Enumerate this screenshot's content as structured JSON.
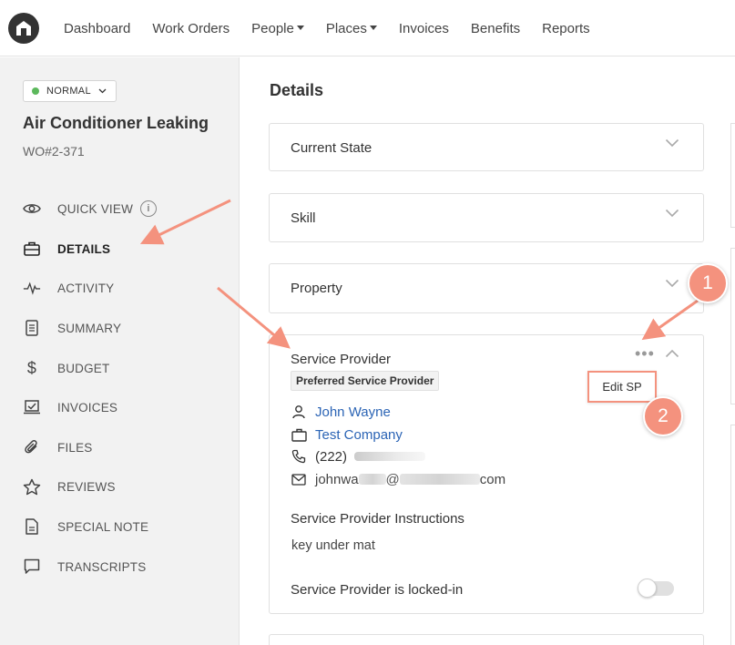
{
  "nav": {
    "items": [
      {
        "label": "Dashboard",
        "dropdown": false
      },
      {
        "label": "Work Orders",
        "dropdown": false
      },
      {
        "label": "People",
        "dropdown": true
      },
      {
        "label": "Places",
        "dropdown": true
      },
      {
        "label": "Invoices",
        "dropdown": false
      },
      {
        "label": "Benefits",
        "dropdown": false
      },
      {
        "label": "Reports",
        "dropdown": false
      }
    ]
  },
  "sidebar": {
    "status": "NORMAL",
    "status_color": "#5cb85c",
    "title": "Air Conditioner Leaking",
    "wo_number": "WO#2-371",
    "items": [
      {
        "label": "QUICK VIEW",
        "icon": "eye-icon",
        "active": false,
        "info": true
      },
      {
        "label": "DETAILS",
        "icon": "briefcase-icon",
        "active": true
      },
      {
        "label": "ACTIVITY",
        "icon": "pulse-icon",
        "active": false
      },
      {
        "label": "SUMMARY",
        "icon": "document-icon",
        "active": false
      },
      {
        "label": "BUDGET",
        "icon": "dollar-icon",
        "active": false
      },
      {
        "label": "INVOICES",
        "icon": "invoice-icon",
        "active": false
      },
      {
        "label": "FILES",
        "icon": "paperclip-icon",
        "active": false
      },
      {
        "label": "REVIEWS",
        "icon": "star-icon",
        "active": false
      },
      {
        "label": "SPECIAL NOTE",
        "icon": "note-icon",
        "active": false
      },
      {
        "label": "TRANSCRIPTS",
        "icon": "chat-icon",
        "active": false
      }
    ]
  },
  "main": {
    "heading": "Details",
    "panels": [
      {
        "title": "Current State"
      },
      {
        "title": "Skill"
      },
      {
        "title": "Property"
      }
    ],
    "service_provider": {
      "title": "Service Provider",
      "label": "Preferred Service Provider",
      "contact_name": "John Wayne",
      "company": "Test Company",
      "phone_prefix": "(222)",
      "email_start": "johnwa",
      "email_mid": "@",
      "email_end": "com",
      "instructions_title": "Service Provider Instructions",
      "instructions": "key under mat",
      "locked_in_label": "Service Provider is locked-in",
      "locked_in": false,
      "edit_label": "Edit SP",
      "more_label": "•••"
    }
  },
  "annotations": {
    "badge_1": "1",
    "badge_2": "2",
    "accent_color": "#f4927e"
  }
}
